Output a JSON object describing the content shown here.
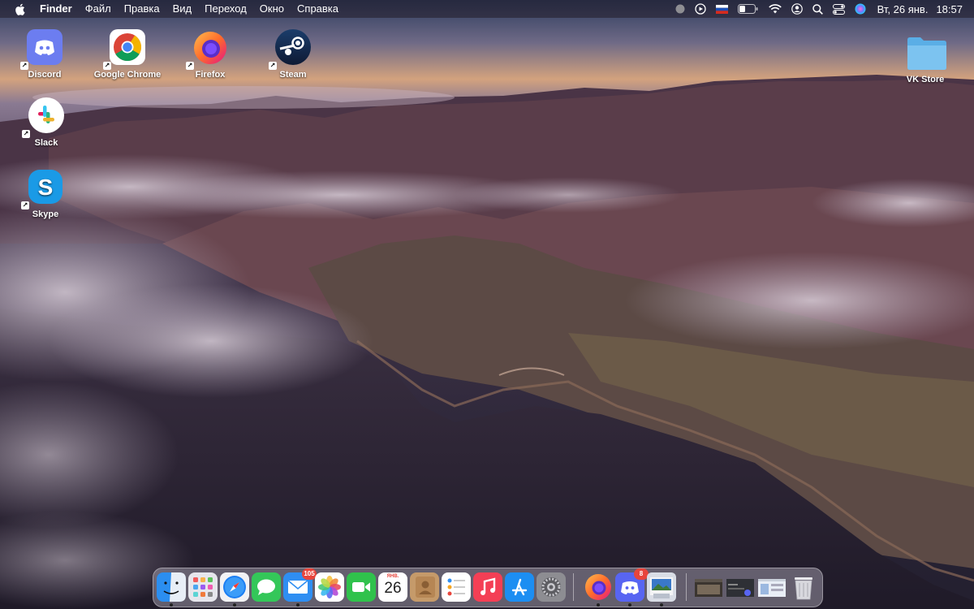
{
  "menubar": {
    "app_name": "Finder",
    "items": [
      "Файл",
      "Правка",
      "Вид",
      "Переход",
      "Окно",
      "Справка"
    ],
    "date": "Вт, 26 янв.",
    "time": "18:57"
  },
  "desktop_icons": [
    {
      "label": "Discord",
      "icon": "discord-icon",
      "alias": true
    },
    {
      "label": "Google Chrome",
      "icon": "chrome-icon",
      "alias": true
    },
    {
      "label": "Firefox",
      "icon": "firefox-icon",
      "alias": true
    },
    {
      "label": "Steam",
      "icon": "steam-icon",
      "alias": true
    },
    {
      "label": "Slack",
      "icon": "slack-icon",
      "alias": true
    },
    {
      "label": "Skype",
      "icon": "skype-icon",
      "alias": true
    },
    {
      "label": "VK Store",
      "icon": "folder-icon",
      "alias": false
    }
  ],
  "dock": {
    "apps": [
      {
        "name": "finder",
        "color": "#2b8ef0",
        "running": true
      },
      {
        "name": "launchpad",
        "color": "#e4e4ea",
        "running": false
      },
      {
        "name": "safari",
        "color": "#1d7ff2",
        "running": true
      },
      {
        "name": "messages",
        "color": "#34c759",
        "running": false
      },
      {
        "name": "mail",
        "color": "#2f8ef2",
        "running": true,
        "badge": "105"
      },
      {
        "name": "photos",
        "color": "#ffffff",
        "running": false
      },
      {
        "name": "facetime",
        "color": "#30c24c",
        "running": false
      },
      {
        "name": "calendar",
        "color": "#ffffff",
        "running": false,
        "month": "ЯНВ.",
        "day": "26"
      },
      {
        "name": "contacts",
        "color": "#c59a6a",
        "running": false
      },
      {
        "name": "reminders",
        "color": "#ffffff",
        "running": false
      },
      {
        "name": "music",
        "color": "#f43f55",
        "running": false
      },
      {
        "name": "app-store",
        "color": "#1c8ef2",
        "running": false
      },
      {
        "name": "system-preferences",
        "color": "#8d8d92",
        "running": false
      },
      {
        "name": "firefox",
        "color": "#ff7a18",
        "running": true
      },
      {
        "name": "discord",
        "color": "#5865f2",
        "running": true,
        "badge": "8"
      },
      {
        "name": "preview",
        "color": "#d9dde6",
        "running": true
      }
    ],
    "recent_windows": [
      {
        "name": "window-thumb-1",
        "color": "#3b3530"
      },
      {
        "name": "window-thumb-2",
        "color": "#2e3035"
      },
      {
        "name": "window-thumb-3",
        "color": "#e9eef6"
      }
    ],
    "trash": {
      "name": "trash"
    }
  }
}
